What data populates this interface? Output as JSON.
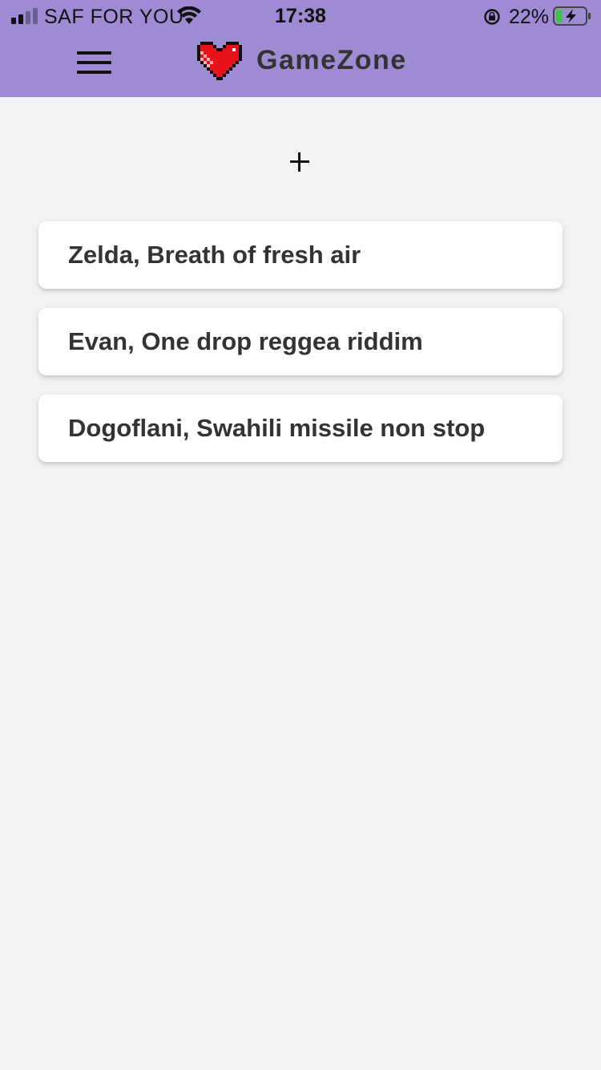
{
  "status_bar": {
    "carrier": "SAF FOR YOU",
    "time": "17:38",
    "battery_percent": "22%",
    "battery_level": 0.22,
    "icons": [
      "signal-icon",
      "wifi-icon",
      "orientation-lock-icon",
      "battery-charging-icon"
    ]
  },
  "header": {
    "title": "GameZone",
    "logo_icon": "pixel-heart-icon",
    "menu_icon": "hamburger-menu-icon",
    "background_color": "#9f8ad4"
  },
  "main": {
    "add_icon": "plus-icon",
    "reviews": [
      {
        "label": "Zelda, Breath of fresh air"
      },
      {
        "label": "Evan, One drop reggea riddim"
      },
      {
        "label": "Dogoflani, Swahili missile non stop"
      }
    ]
  },
  "colors": {
    "background": "#f2f2f2",
    "card": "#ffffff",
    "text": "#333333",
    "heart": "#e8141c"
  }
}
